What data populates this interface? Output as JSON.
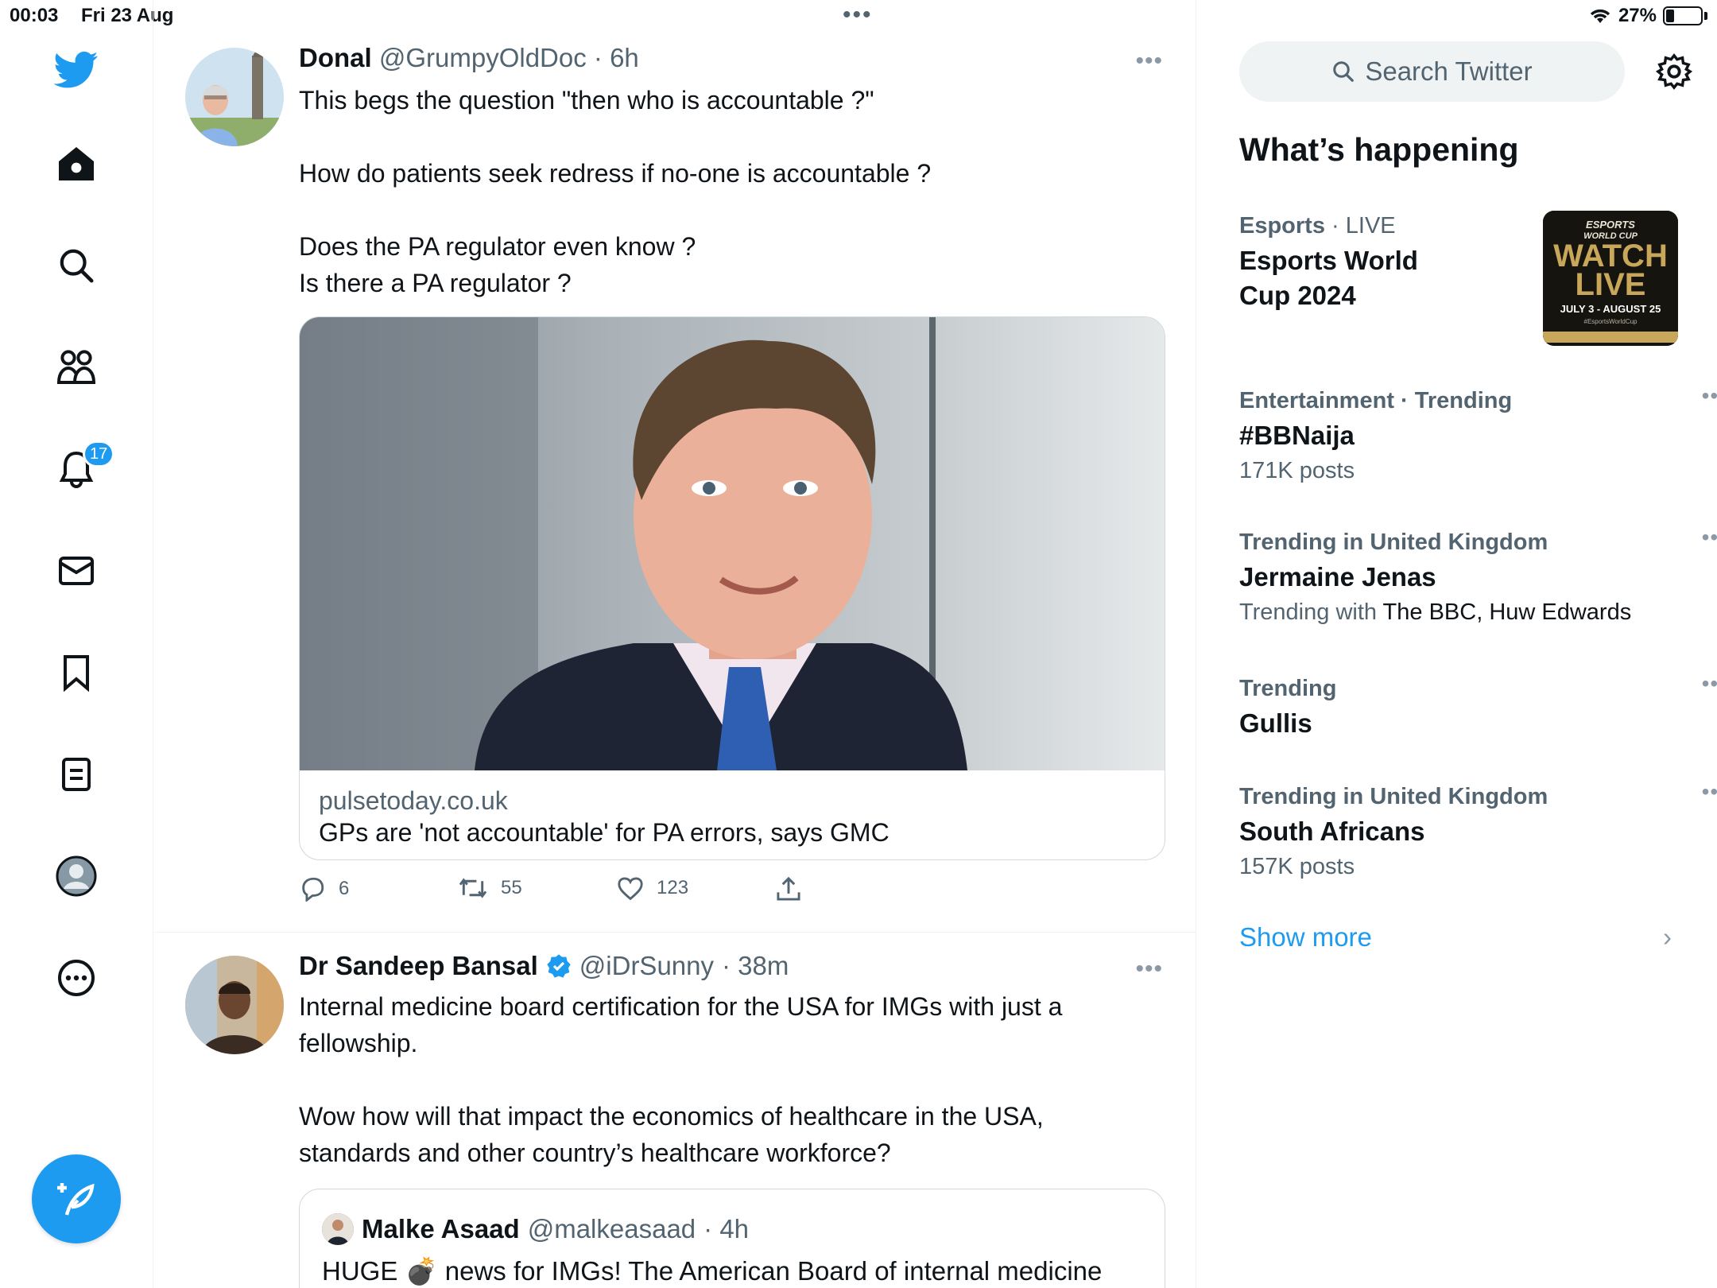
{
  "status_bar": {
    "time": "00:03",
    "date": "Fri 23 Aug",
    "battery": "27%"
  },
  "nav": {
    "notifications_badge": "17"
  },
  "tweets": [
    {
      "name": "Donal",
      "handle": "@GrumpyOldDoc",
      "time": "· 6h",
      "text": [
        "This begs the question \"then who is accountable ?\"",
        "",
        "How do patients seek redress if no-one is accountable ?",
        "",
        "Does the PA regulator even know ?",
        "Is there a PA regulator ?"
      ],
      "card": {
        "domain": "pulsetoday.co.uk",
        "title": "GPs are 'not accountable' for PA errors, says GMC"
      },
      "actions": {
        "replies": "6",
        "retweets": "55",
        "likes": "123"
      }
    },
    {
      "name": "Dr Sandeep Bansal",
      "handle": "@iDrSunny",
      "time": "· 38m",
      "text": [
        "Internal medicine board certification for the USA for IMGs with just a",
        "fellowship.",
        "",
        "Wow how will that impact the economics of healthcare in the USA,",
        "standards and other country’s healthcare workforce?"
      ],
      "quote": {
        "name": "Malke Asaad",
        "handle": "@malkeasaad",
        "time": "· 4h",
        "text": "HUGE 💣 news for IMGs! The American Board of internal medicine"
      }
    }
  ],
  "sidebar": {
    "search_placeholder": "Search Twitter",
    "whats_happening": "What’s happening",
    "trends": [
      {
        "meta_bold": "Esports",
        "meta_rest": " · LIVE",
        "name_lines": [
          "Esports World",
          "Cup 2024"
        ],
        "sub": ""
      },
      {
        "meta_bold": "Entertainment · Trending",
        "meta_rest": "",
        "name_lines": [
          "#BBNaija"
        ],
        "sub": "171K posts"
      },
      {
        "meta_bold": "Trending in United Kingdom",
        "meta_rest": "",
        "name_lines": [
          "Jermaine Jenas"
        ],
        "sub_prefix": "Trending with ",
        "sub_dark": "The BBC, Huw Edwards"
      },
      {
        "meta_bold": "Trending",
        "meta_rest": "",
        "name_lines": [
          "Gullis"
        ],
        "sub": ""
      },
      {
        "meta_bold": "Trending in United Kingdom",
        "meta_rest": "",
        "name_lines": [
          "South Africans"
        ],
        "sub": "157K posts"
      }
    ],
    "promo": {
      "line1": "ESPORTS",
      "line2": "WORLD CUP",
      "line3": "WATCH",
      "line4": "LIVE",
      "dates": "JULY 3 - AUGUST 25",
      "hashtag": "#EsportsWorldCup"
    },
    "show_more": "Show more"
  },
  "colors": {
    "accent": "#1d9bf0",
    "text": "#0f1419",
    "muted": "#536471",
    "border": "#cfd9de"
  }
}
